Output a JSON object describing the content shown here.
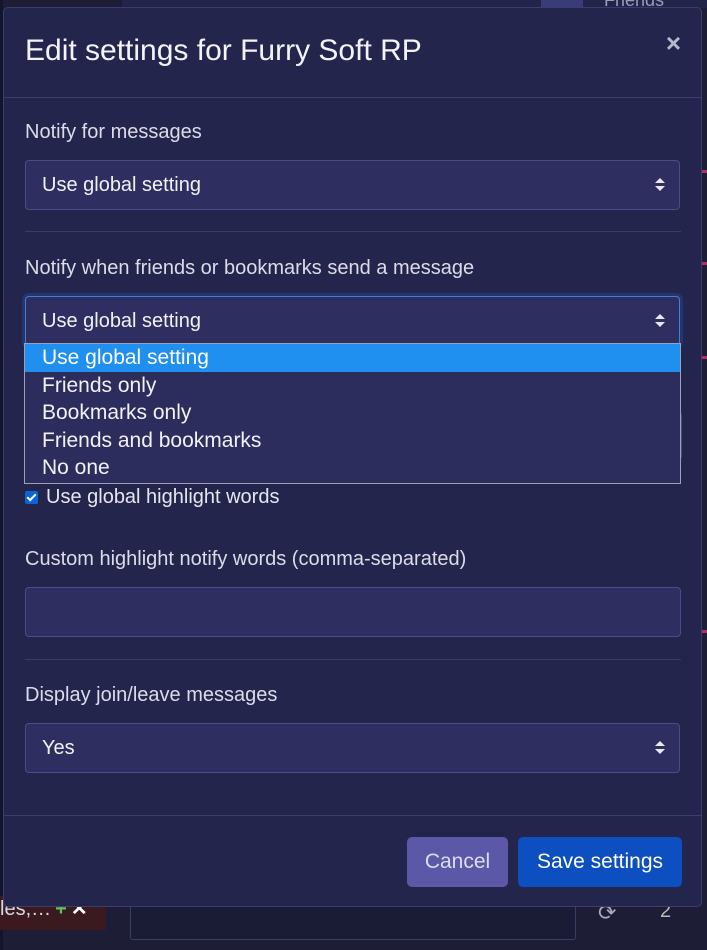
{
  "background": {
    "top_text": "Friends",
    "bottom_left_text": "les,…",
    "count": "2"
  },
  "modal": {
    "title": "Edit settings for Furry Soft RP",
    "close_label": "×",
    "fields": {
      "notify_messages": {
        "label": "Notify for messages",
        "value": "Use global setting"
      },
      "notify_friends": {
        "label": "Notify when friends or bookmarks send a message",
        "value": "Use global setting",
        "options": [
          "Use global setting",
          "Friends only",
          "Bookmarks only",
          "Friends and bookmarks",
          "No one"
        ],
        "highlighted_option": "Use global setting"
      },
      "global_highlight": {
        "label": "Use global highlight words",
        "checked": true
      },
      "custom_highlight": {
        "label": "Custom highlight notify words (comma-separated)",
        "value": ""
      },
      "join_leave": {
        "label": "Display join/leave messages",
        "value": "Yes"
      }
    },
    "buttons": {
      "cancel": "Cancel",
      "save": "Save settings"
    }
  },
  "colors": {
    "modal_bg": "#24254d",
    "select_bg": "#2e2f60",
    "accent": "#0d4fc0",
    "highlight": "#1f8ff0"
  }
}
